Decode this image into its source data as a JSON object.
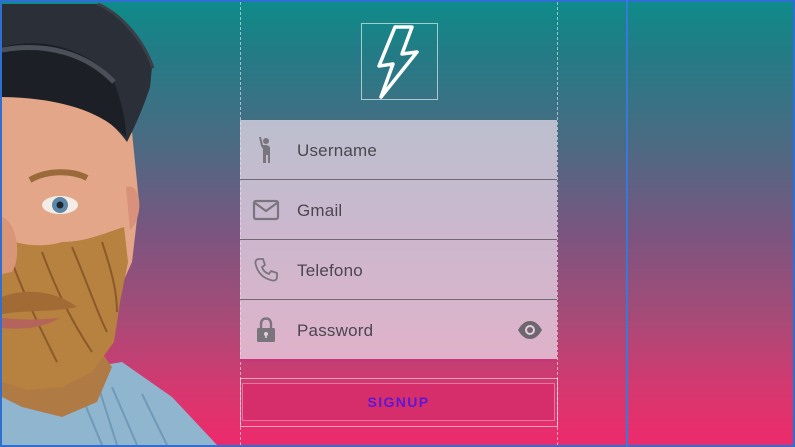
{
  "form": {
    "fields": [
      {
        "label": "Username",
        "icon": "person-waving-icon"
      },
      {
        "label": "Gmail",
        "icon": "mail-icon"
      },
      {
        "label": "Telefono",
        "icon": "phone-icon"
      },
      {
        "label": "Password",
        "icon": "lock-icon",
        "toggle_icon": "eye-icon"
      }
    ],
    "submit_label": "SIGNUP"
  },
  "logo": {
    "icon": "lightning-bolt-icon"
  },
  "colors": {
    "gradient_top": "#0d8c8a",
    "gradient_bottom": "#ee2a6b",
    "button_bg": "#d62d6b",
    "button_text": "#5c17d6",
    "field_text": "#4b4650",
    "guide_line": "#2f6fd1"
  }
}
